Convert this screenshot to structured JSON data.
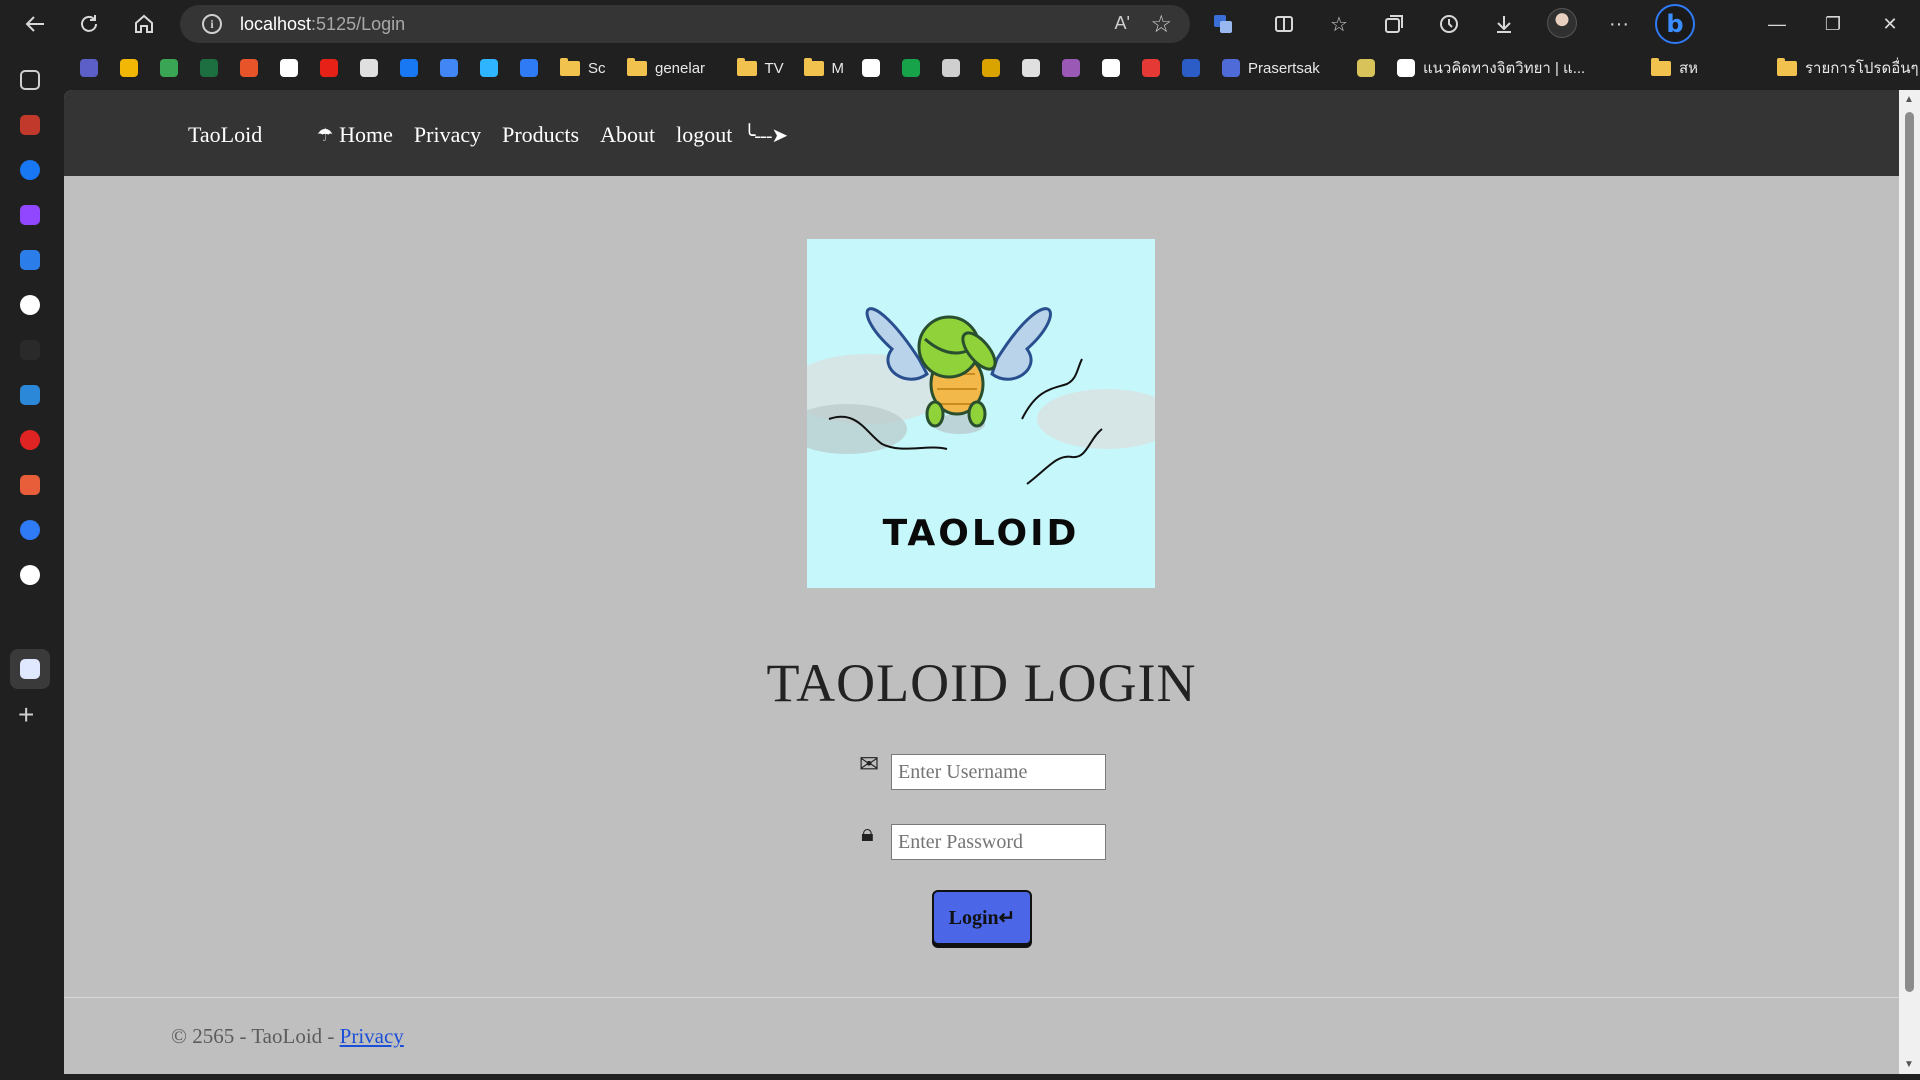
{
  "browser": {
    "url_host": "localhost",
    "url_path": ":5125/Login",
    "read_aloud": "Aʹ",
    "favorites": [
      {
        "label": "",
        "kind": "icon",
        "color": "#5b5fc7"
      },
      {
        "label": "",
        "kind": "icon",
        "color": "#f2b705"
      },
      {
        "label": "",
        "kind": "icon",
        "color": "#3aa655"
      },
      {
        "label": "",
        "kind": "icon",
        "color": "#1d6f42"
      },
      {
        "label": "",
        "kind": "icon",
        "color": "#e8542a"
      },
      {
        "label": "",
        "kind": "icon",
        "color": "#ffffff"
      },
      {
        "label": "",
        "kind": "icon",
        "color": "#e62117"
      },
      {
        "label": "",
        "kind": "icon",
        "color": "#e0e0e0"
      },
      {
        "label": "",
        "kind": "icon",
        "color": "#1877f2"
      },
      {
        "label": "",
        "kind": "icon",
        "color": "#4285f4"
      },
      {
        "label": "",
        "kind": "icon",
        "color": "#2fb5ff"
      },
      {
        "label": "",
        "kind": "icon",
        "color": "#2f7bf6"
      },
      {
        "label": "Sc",
        "kind": "folder"
      },
      {
        "label": "genelar",
        "kind": "folder"
      },
      {
        "label": "TV",
        "kind": "folder"
      },
      {
        "label": "M",
        "kind": "folder"
      },
      {
        "label": "",
        "kind": "icon",
        "color": "#ffffff"
      },
      {
        "label": "",
        "kind": "icon",
        "color": "#16a34a"
      },
      {
        "label": "",
        "kind": "icon",
        "color": "#cfcfcf"
      },
      {
        "label": "",
        "kind": "icon",
        "color": "#d9a400"
      },
      {
        "label": "",
        "kind": "icon",
        "color": "#e0e0e0"
      },
      {
        "label": "",
        "kind": "icon",
        "color": "#9b59b6"
      },
      {
        "label": "",
        "kind": "icon",
        "color": "#ffffff"
      },
      {
        "label": "",
        "kind": "icon",
        "color": "#e53935"
      },
      {
        "label": "",
        "kind": "icon",
        "color": "#2c5cc5"
      },
      {
        "label": "Prasertsak",
        "kind": "icon",
        "color": "#4f6bd8"
      },
      {
        "label": "",
        "kind": "icon",
        "color": "#d8c25a"
      },
      {
        "label": "แนวคิดทางจิตวิทยา | แ...",
        "kind": "icon",
        "color": "#ffffff"
      },
      {
        "label": "สห",
        "kind": "folder"
      },
      {
        "label": "รายการโปรดอื่นๆ",
        "kind": "folder"
      }
    ]
  },
  "site": {
    "brand": "TaoLoid",
    "nav": {
      "home_icon": "☂",
      "home": "Home",
      "privacy": "Privacy",
      "products": "Products",
      "about": "About",
      "logout": "logout",
      "logout_arrow": "╰---➤"
    },
    "logo_text": "TAOLOID",
    "title": "TAOLOID LOGIN",
    "username": {
      "icon": "✉",
      "placeholder": "Enter Username"
    },
    "password": {
      "icon": "🔒︎",
      "placeholder": "Enter Password"
    },
    "login_button": "Login↵",
    "footer": {
      "text": "© 2565 - TaoLoid - ",
      "link": "Privacy"
    }
  }
}
